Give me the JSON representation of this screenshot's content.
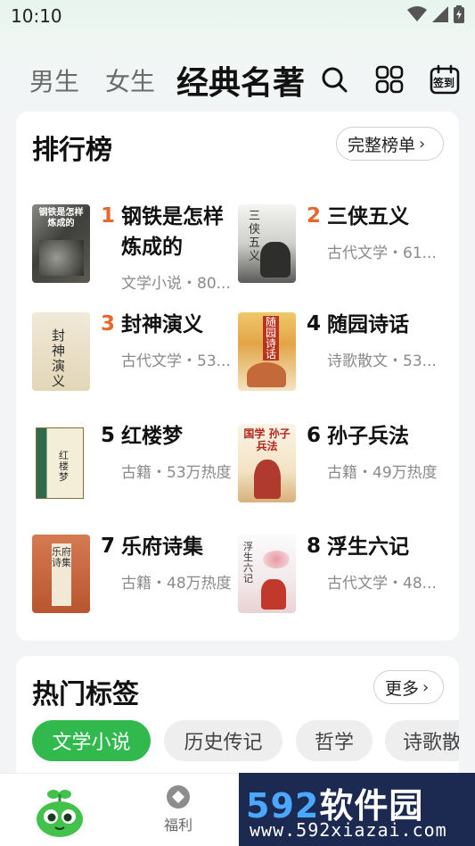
{
  "status": {
    "time": "10:10"
  },
  "nav": {
    "tabs": [
      "男生",
      "女生",
      "经典名著"
    ],
    "signin_label": "签到"
  },
  "ranking": {
    "title": "排行榜",
    "full_list_label": "完整榜单",
    "books": [
      {
        "rank": "1",
        "title": "钢铁是怎样炼成的",
        "meta": "文学小说・80...",
        "cover_text": "钢铁是怎样炼成的"
      },
      {
        "rank": "2",
        "title": "三侠五义",
        "meta": "古代文学・61...",
        "cover_text": "三侠五义"
      },
      {
        "rank": "3",
        "title": "封神演义",
        "meta": "古代文学・53...",
        "cover_text": "封神演义"
      },
      {
        "rank": "4",
        "title": "随园诗话",
        "meta": "诗歌散文・53...",
        "cover_text": "随园诗话"
      },
      {
        "rank": "5",
        "title": "红楼梦",
        "meta": "古籍・53万热度",
        "cover_text": "红楼梦"
      },
      {
        "rank": "6",
        "title": "孙子兵法",
        "meta": "古籍・49万热度",
        "cover_text": "国学 孙子兵法"
      },
      {
        "rank": "7",
        "title": "乐府诗集",
        "meta": "古籍・48万热度",
        "cover_text": "乐府诗集"
      },
      {
        "rank": "8",
        "title": "浮生六记",
        "meta": "古代文学・48...",
        "cover_text": "浮生六记"
      }
    ]
  },
  "tags": {
    "title": "热门标签",
    "more_label": "更多",
    "items": [
      "文学小说",
      "历史传记",
      "哲学",
      "诗歌散"
    ]
  },
  "bottom": {
    "welfare_label": "福利"
  },
  "watermark": {
    "brand_num": "592",
    "brand_text": "软件园",
    "url": "www.592xiazai.com"
  },
  "colors": {
    "accent_green": "#32b94e",
    "rank_top_orange": "#e8672a"
  }
}
